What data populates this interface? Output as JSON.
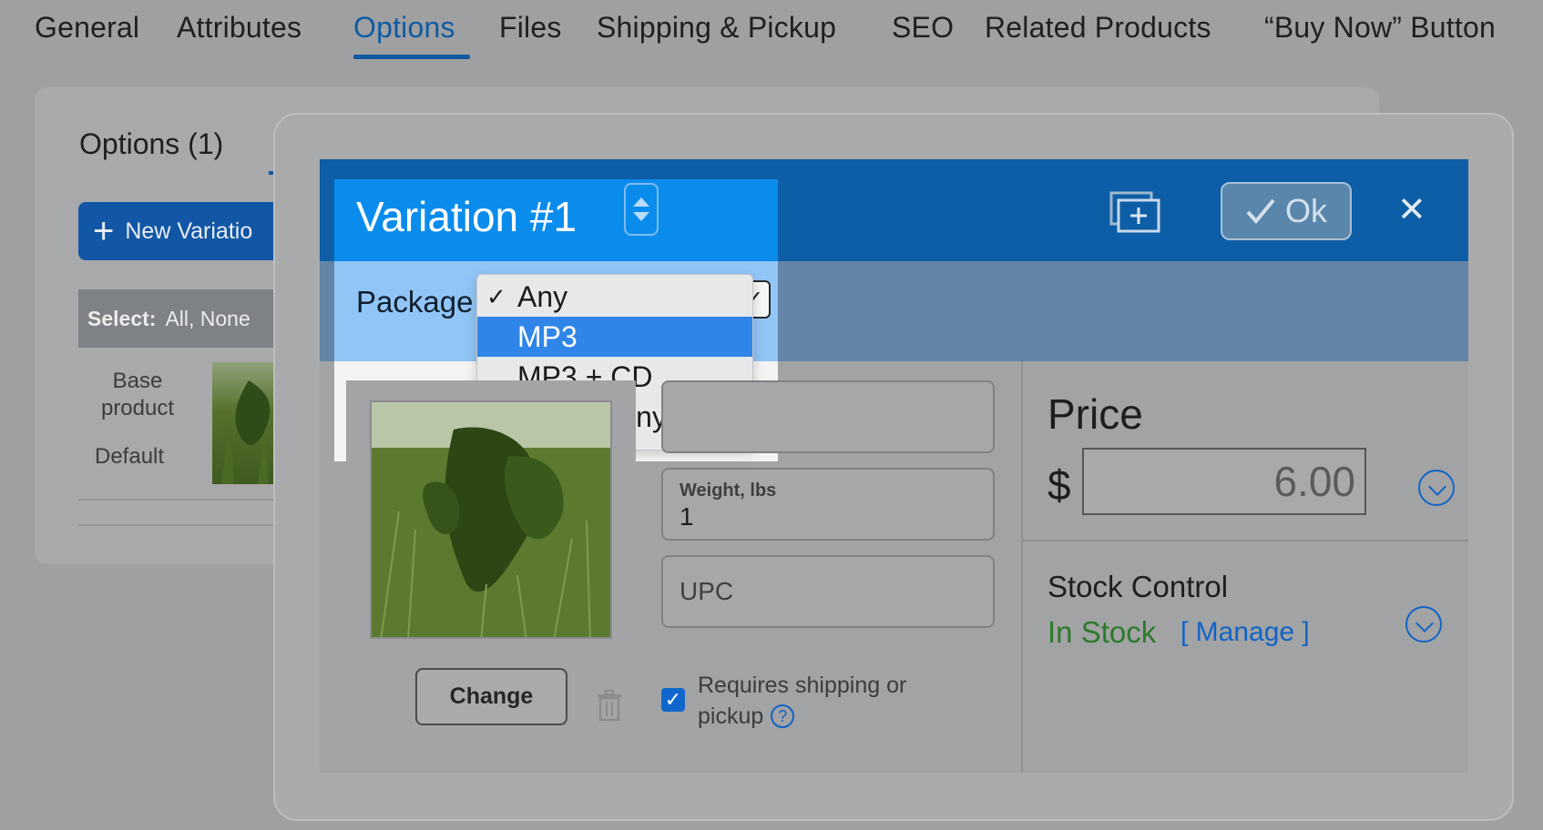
{
  "top_tabs": [
    {
      "label": "General"
    },
    {
      "label": "Attributes"
    },
    {
      "label": "Options",
      "active": true
    },
    {
      "label": "Files"
    },
    {
      "label": "Shipping & Pickup"
    },
    {
      "label": "SEO"
    },
    {
      "label": "Related Products"
    },
    {
      "label": "“Buy Now” Button"
    }
  ],
  "background_panel": {
    "title": "Options (1)",
    "new_variation_label": "New Variatio",
    "select_label": "Select:",
    "select_links": "All, None",
    "base_product_label": "Base product",
    "default_label": "Default"
  },
  "modal": {
    "title": "Variation #1",
    "ok_label": "Ok",
    "package_label": "Package",
    "package_options": [
      "Any",
      "MP3",
      "MP3 + CD",
      "MP3 + Vinyl"
    ],
    "package_checked": "Any",
    "package_highlighted": "MP3",
    "change_label": "Change",
    "weight_label": "Weight, lbs",
    "weight_value": "1",
    "upc_placeholder": "UPC",
    "requires_shipping_label": "Requires shipping or pickup",
    "requires_shipping_line1": "Requires shipping or",
    "requires_shipping_line2": "pickup",
    "requires_shipping_checked": true,
    "price_label": "Price",
    "currency_symbol": "$",
    "price_value": "6.00",
    "stock_control_label": "Stock Control",
    "stock_status": "In Stock",
    "manage_label": "[ Manage ]"
  },
  "colors": {
    "accent": "#0f5aa3",
    "header_blue": "#0d5ea6",
    "highlight_blue": "#0a8cec",
    "selected_option": "#2f86e8",
    "in_stock_green": "#2b7a2b"
  },
  "icons": {
    "stepper": "up-down-stepper-icon",
    "add": "add-copy-icon",
    "ok_check": "checkmark-icon",
    "close": "close-icon",
    "trash": "trash-icon",
    "help": "help-icon",
    "expand": "chevron-down-circle-icon"
  }
}
